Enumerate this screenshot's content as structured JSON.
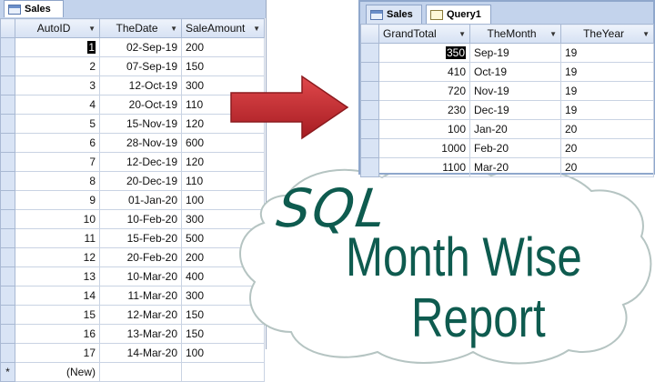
{
  "sales_window": {
    "tab_label": "Sales",
    "columns": [
      {
        "label": "AutoID"
      },
      {
        "label": "TheDate"
      },
      {
        "label": "SaleAmount"
      }
    ],
    "rows": [
      {
        "id": "1",
        "date": "02-Sep-19",
        "amount": "200"
      },
      {
        "id": "2",
        "date": "07-Sep-19",
        "amount": "150"
      },
      {
        "id": "3",
        "date": "12-Oct-19",
        "amount": "300"
      },
      {
        "id": "4",
        "date": "20-Oct-19",
        "amount": "110"
      },
      {
        "id": "5",
        "date": "15-Nov-19",
        "amount": "120"
      },
      {
        "id": "6",
        "date": "28-Nov-19",
        "amount": "600"
      },
      {
        "id": "7",
        "date": "12-Dec-19",
        "amount": "120"
      },
      {
        "id": "8",
        "date": "20-Dec-19",
        "amount": "110"
      },
      {
        "id": "9",
        "date": "01-Jan-20",
        "amount": "100"
      },
      {
        "id": "10",
        "date": "10-Feb-20",
        "amount": "300"
      },
      {
        "id": "11",
        "date": "15-Feb-20",
        "amount": "500"
      },
      {
        "id": "12",
        "date": "20-Feb-20",
        "amount": "200"
      },
      {
        "id": "13",
        "date": "10-Mar-20",
        "amount": "400"
      },
      {
        "id": "14",
        "date": "11-Mar-20",
        "amount": "300"
      },
      {
        "id": "15",
        "date": "12-Mar-20",
        "amount": "150"
      },
      {
        "id": "16",
        "date": "13-Mar-20",
        "amount": "150"
      },
      {
        "id": "17",
        "date": "14-Mar-20",
        "amount": "100"
      }
    ],
    "new_row_marker": "*",
    "new_row_label": "(New)"
  },
  "query_window": {
    "tabs": [
      {
        "label": "Sales"
      },
      {
        "label": "Query1"
      }
    ],
    "columns": [
      {
        "label": "GrandTotal"
      },
      {
        "label": "TheMonth"
      },
      {
        "label": "TheYear"
      }
    ],
    "rows": [
      {
        "total": "350",
        "month": "Sep-19",
        "year": "19"
      },
      {
        "total": "410",
        "month": "Oct-19",
        "year": "19"
      },
      {
        "total": "720",
        "month": "Nov-19",
        "year": "19"
      },
      {
        "total": "230",
        "month": "Dec-19",
        "year": "19"
      },
      {
        "total": "100",
        "month": "Jan-20",
        "year": "20"
      },
      {
        "total": "1000",
        "month": "Feb-20",
        "year": "20"
      },
      {
        "total": "1100",
        "month": "Mar-20",
        "year": "20"
      }
    ]
  },
  "overlay": {
    "line1": "SQL",
    "line2": "Month Wise",
    "line3": "Report"
  },
  "colors": {
    "arrow": "#c0262c",
    "title_text": "#0e5b4f",
    "header_bg": "#d6e1f3"
  }
}
